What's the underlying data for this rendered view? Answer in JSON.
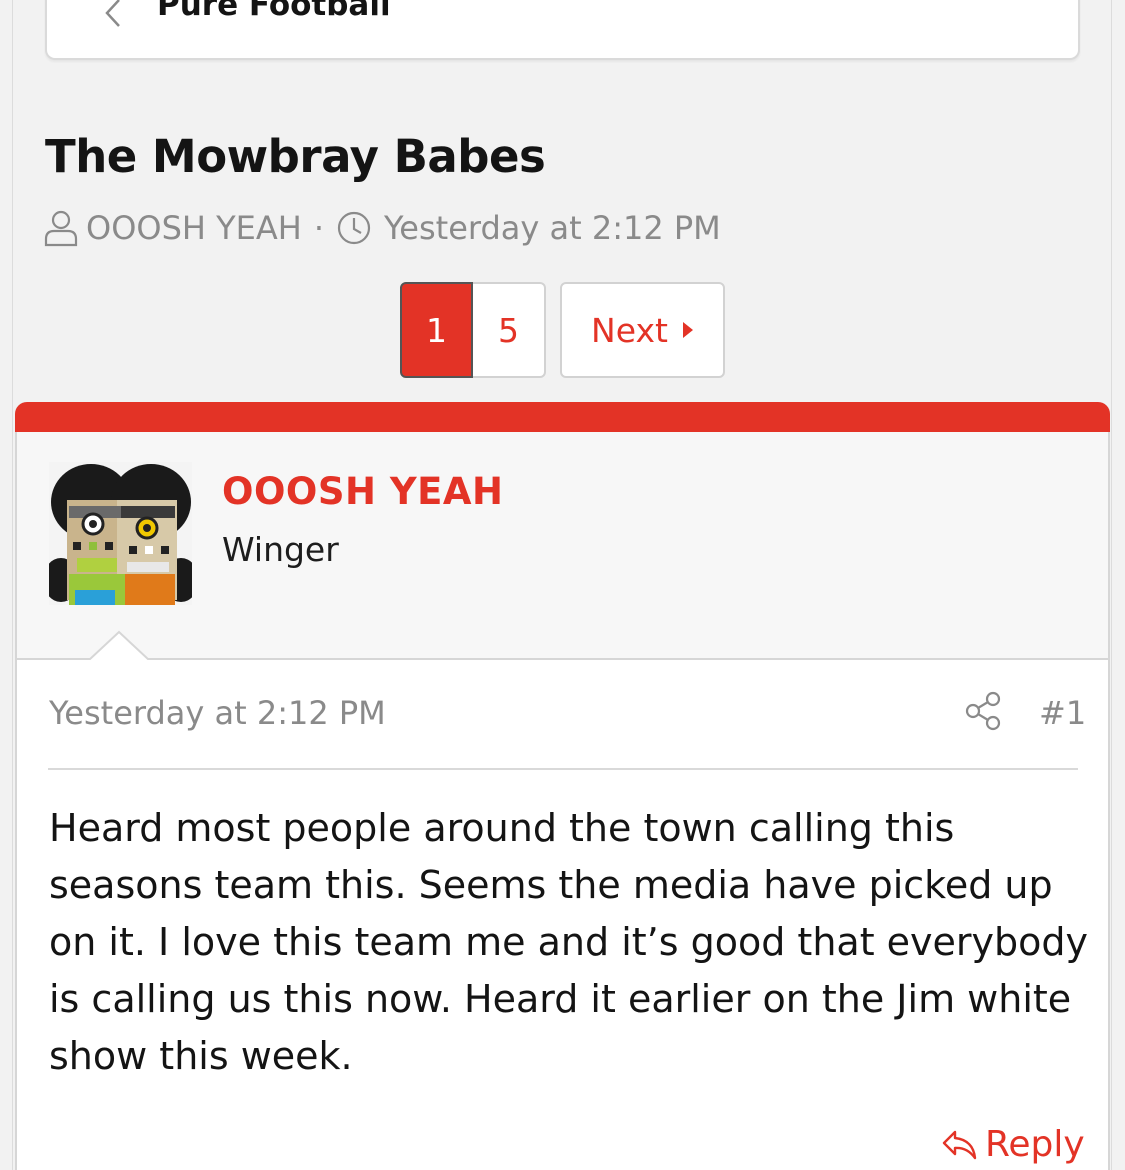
{
  "breadcrumb": {
    "label": "Pure Football"
  },
  "thread": {
    "title": "The Mowbray Babes",
    "author": "OOOSH YEAH",
    "separator": "·",
    "date": "Yesterday at 2:12 PM"
  },
  "pagination": {
    "current": "1",
    "last": "5",
    "next_label": "Next"
  },
  "post": {
    "username": "OOOSH YEAH",
    "user_title": "Winger",
    "date": "Yesterday at 2:12 PM",
    "number": "#1",
    "body": "Heard most people around the town calling this seasons team this. Seems the media have picked up on it. I love this team me and it’s good that everybody is calling us this now. Heard it earlier on the Jim white show this week.",
    "reply_label": "Reply"
  },
  "colors": {
    "accent": "#e33326",
    "muted": "#8a8a8a"
  },
  "icons": [
    "chevron-left-icon",
    "user-icon",
    "clock-icon",
    "caret-right-icon",
    "share-icon",
    "reply-icon"
  ]
}
